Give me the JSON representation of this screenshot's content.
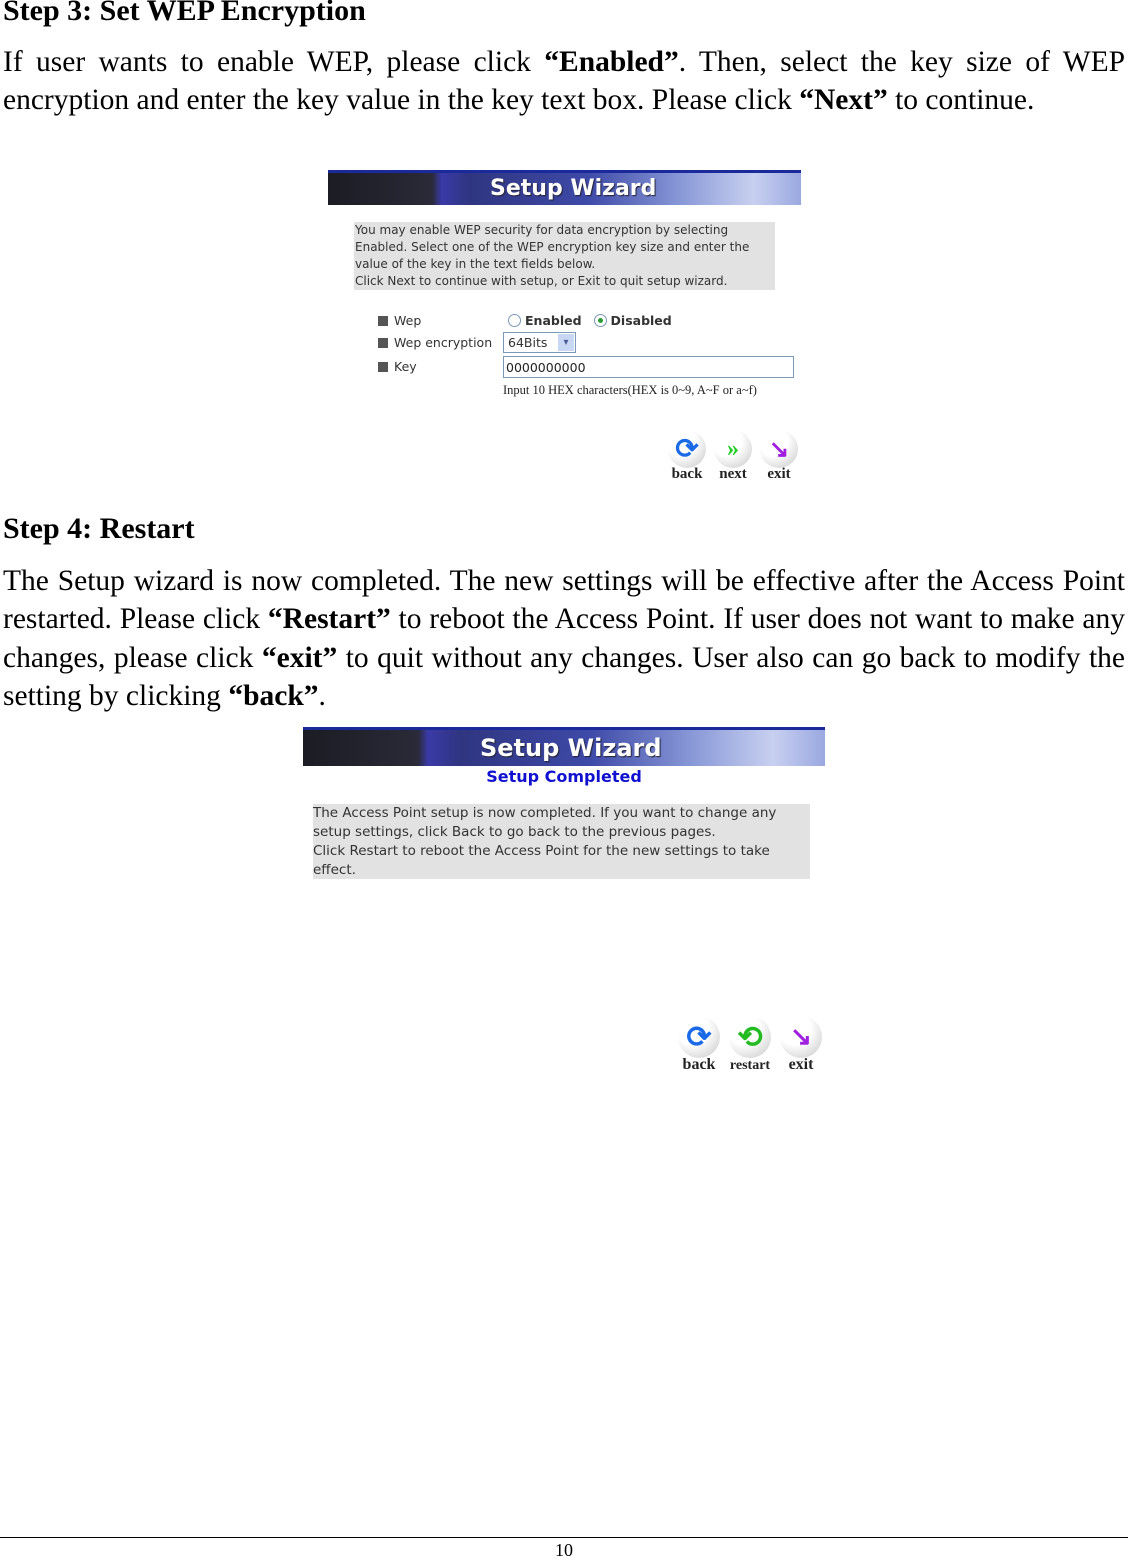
{
  "step3": {
    "heading": "Step 3: Set WEP Encryption",
    "paragraph": [
      {
        "text": "If user wants to enable WEP, please click ",
        "bold": false
      },
      {
        "text": "“Enabled”",
        "bold": true
      },
      {
        "text": ". Then, select the key size of WEP encryption and enter the key value in the key text box. Please click ",
        "bold": false
      },
      {
        "text": "“Next”",
        "bold": true
      },
      {
        "text": " to continue.",
        "bold": false
      }
    ],
    "screenshot": {
      "banner_title": "Setup Wizard",
      "info_lines": [
        "You may enable WEP security for data encryption by selecting",
        "Enabled. Select one of the WEP encryption key size and enter the",
        "value of the key in the text fields below.",
        "Click Next to continue with setup, or Exit to quit setup wizard."
      ],
      "wep_label": "Wep",
      "wep_options": [
        "Enabled",
        "Disabled"
      ],
      "wep_selected": "Disabled",
      "encryption_label": "Wep encryption",
      "encryption_value": "64Bits",
      "key_label": "Key",
      "key_value": "0000000000",
      "key_hint": "Input 10 HEX characters(HEX is 0~9, A~F or a~f)",
      "buttons": {
        "back": "back",
        "next": "next",
        "exit": "exit"
      }
    }
  },
  "step4": {
    "heading": "Step 4: Restart",
    "paragraph": [
      {
        "text": "The Setup wizard is now completed. The new settings will be effective after the Access Point restarted. Please click ",
        "bold": false
      },
      {
        "text": "“Restart”",
        "bold": true
      },
      {
        "text": " to reboot the Access Point. If user does not want to make any changes, please click ",
        "bold": false
      },
      {
        "text": "“exit”",
        "bold": true
      },
      {
        "text": " to quit without any changes. User also can go back to modify the setting by clicking ",
        "bold": false
      },
      {
        "text": "“back”",
        "bold": true
      },
      {
        "text": ".",
        "bold": false
      }
    ],
    "screenshot": {
      "banner_title": "Setup Wizard",
      "subtitle": "Setup Completed",
      "info_lines": [
        "The Access Point setup is now completed. If you want to change any",
        "setup settings, click Back to go back to the previous pages.",
        "Click Restart to reboot the Access Point for the new settings to take",
        "effect."
      ],
      "buttons": {
        "back": "back",
        "restart": "restart",
        "exit": "exit"
      }
    }
  },
  "footer": {
    "page_number": "10"
  },
  "colors": {
    "subtitle": "#1010d0",
    "info_box": "#e2e2e2",
    "back_icon": "#1a6ae8",
    "next_icon": "#22cc22",
    "exit_icon": "#a020e0"
  }
}
